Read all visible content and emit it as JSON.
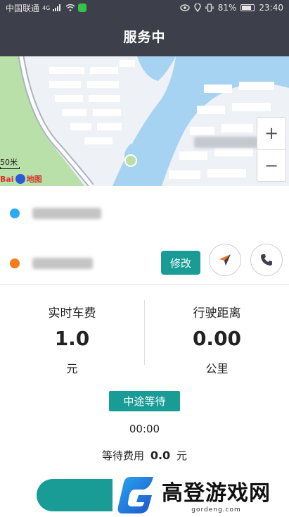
{
  "status_bar": {
    "carrier": "中国联通",
    "network": "4G",
    "battery": "81%",
    "battery_level": 0.81,
    "time": "23:40"
  },
  "header": {
    "title": "服务中"
  },
  "map": {
    "scale_label": "50米",
    "logo_text": "Bai",
    "logo_suffix": "地图",
    "zoom_in": "+",
    "zoom_out": "−"
  },
  "trip": {
    "modify_label": "修改"
  },
  "stats": {
    "fare_label": "实时车费",
    "fare_value": "1.0",
    "fare_unit": "元",
    "distance_label": "行驶距离",
    "distance_value": "0.00",
    "distance_unit": "公里"
  },
  "waiting": {
    "button_label": "中途等待",
    "time": "00:00",
    "fee_label": "等待费用",
    "fee_value": "0.0",
    "fee_unit": "元"
  },
  "watermark": {
    "title": "高登游戏网",
    "url": "gordeng.com"
  },
  "colors": {
    "header_bg": "#3d3f4a",
    "accent": "#1a9c96",
    "start_dot": "#2baaf2",
    "end_dot": "#f27d1a"
  }
}
